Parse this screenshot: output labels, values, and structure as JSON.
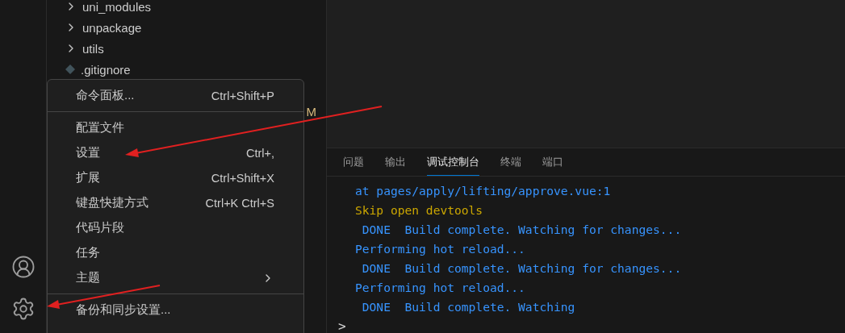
{
  "explorer": {
    "items": [
      {
        "kind": "folder",
        "label": "uni_modules"
      },
      {
        "kind": "folder",
        "label": "unpackage"
      },
      {
        "kind": "folder",
        "label": "utils"
      },
      {
        "kind": "file",
        "label": ".gitignore"
      }
    ],
    "hidden_row_status": "M"
  },
  "activity_bar": {
    "items": [
      {
        "kind": "account"
      },
      {
        "kind": "settings"
      }
    ]
  },
  "panel": {
    "tabs": [
      {
        "label": "问题",
        "selected": false
      },
      {
        "label": "输出",
        "selected": false
      },
      {
        "label": "调试控制台",
        "selected": true
      },
      {
        "label": "终端",
        "selected": false
      },
      {
        "label": "端口",
        "selected": false
      }
    ],
    "lines": [
      {
        "kind": "info",
        "text": "at pages/apply/lifting/approve.vue:1"
      },
      {
        "kind": "warning",
        "text": "Skip open devtools"
      },
      {
        "kind": "info",
        "text": " DONE  Build complete. Watching for changes..."
      },
      {
        "kind": "info",
        "text": "Performing hot reload..."
      },
      {
        "kind": "info",
        "text": " DONE  Build complete. Watching for changes..."
      },
      {
        "kind": "info",
        "text": "Performing hot reload..."
      },
      {
        "kind": "info",
        "text": " DONE  Build complete. Watching"
      }
    ],
    "prompt": ">"
  },
  "menu": {
    "groups": [
      {
        "items": [
          {
            "kind": "command",
            "label": "命令面板...",
            "shortcut": "Ctrl+Shift+P"
          }
        ]
      },
      {
        "items": [
          {
            "kind": "command",
            "label": "配置文件"
          },
          {
            "kind": "command",
            "label": "设置",
            "shortcut": "Ctrl+,"
          },
          {
            "kind": "command",
            "label": "扩展",
            "shortcut": "Ctrl+Shift+X"
          },
          {
            "kind": "command",
            "label": "键盘快捷方式",
            "shortcut": "Ctrl+K Ctrl+S"
          },
          {
            "kind": "command",
            "label": "代码片段"
          },
          {
            "kind": "command",
            "label": "任务"
          },
          {
            "kind": "submenu",
            "label": "主题"
          }
        ]
      },
      {
        "items": [
          {
            "kind": "command",
            "label": "备份和同步设置..."
          }
        ]
      }
    ]
  }
}
